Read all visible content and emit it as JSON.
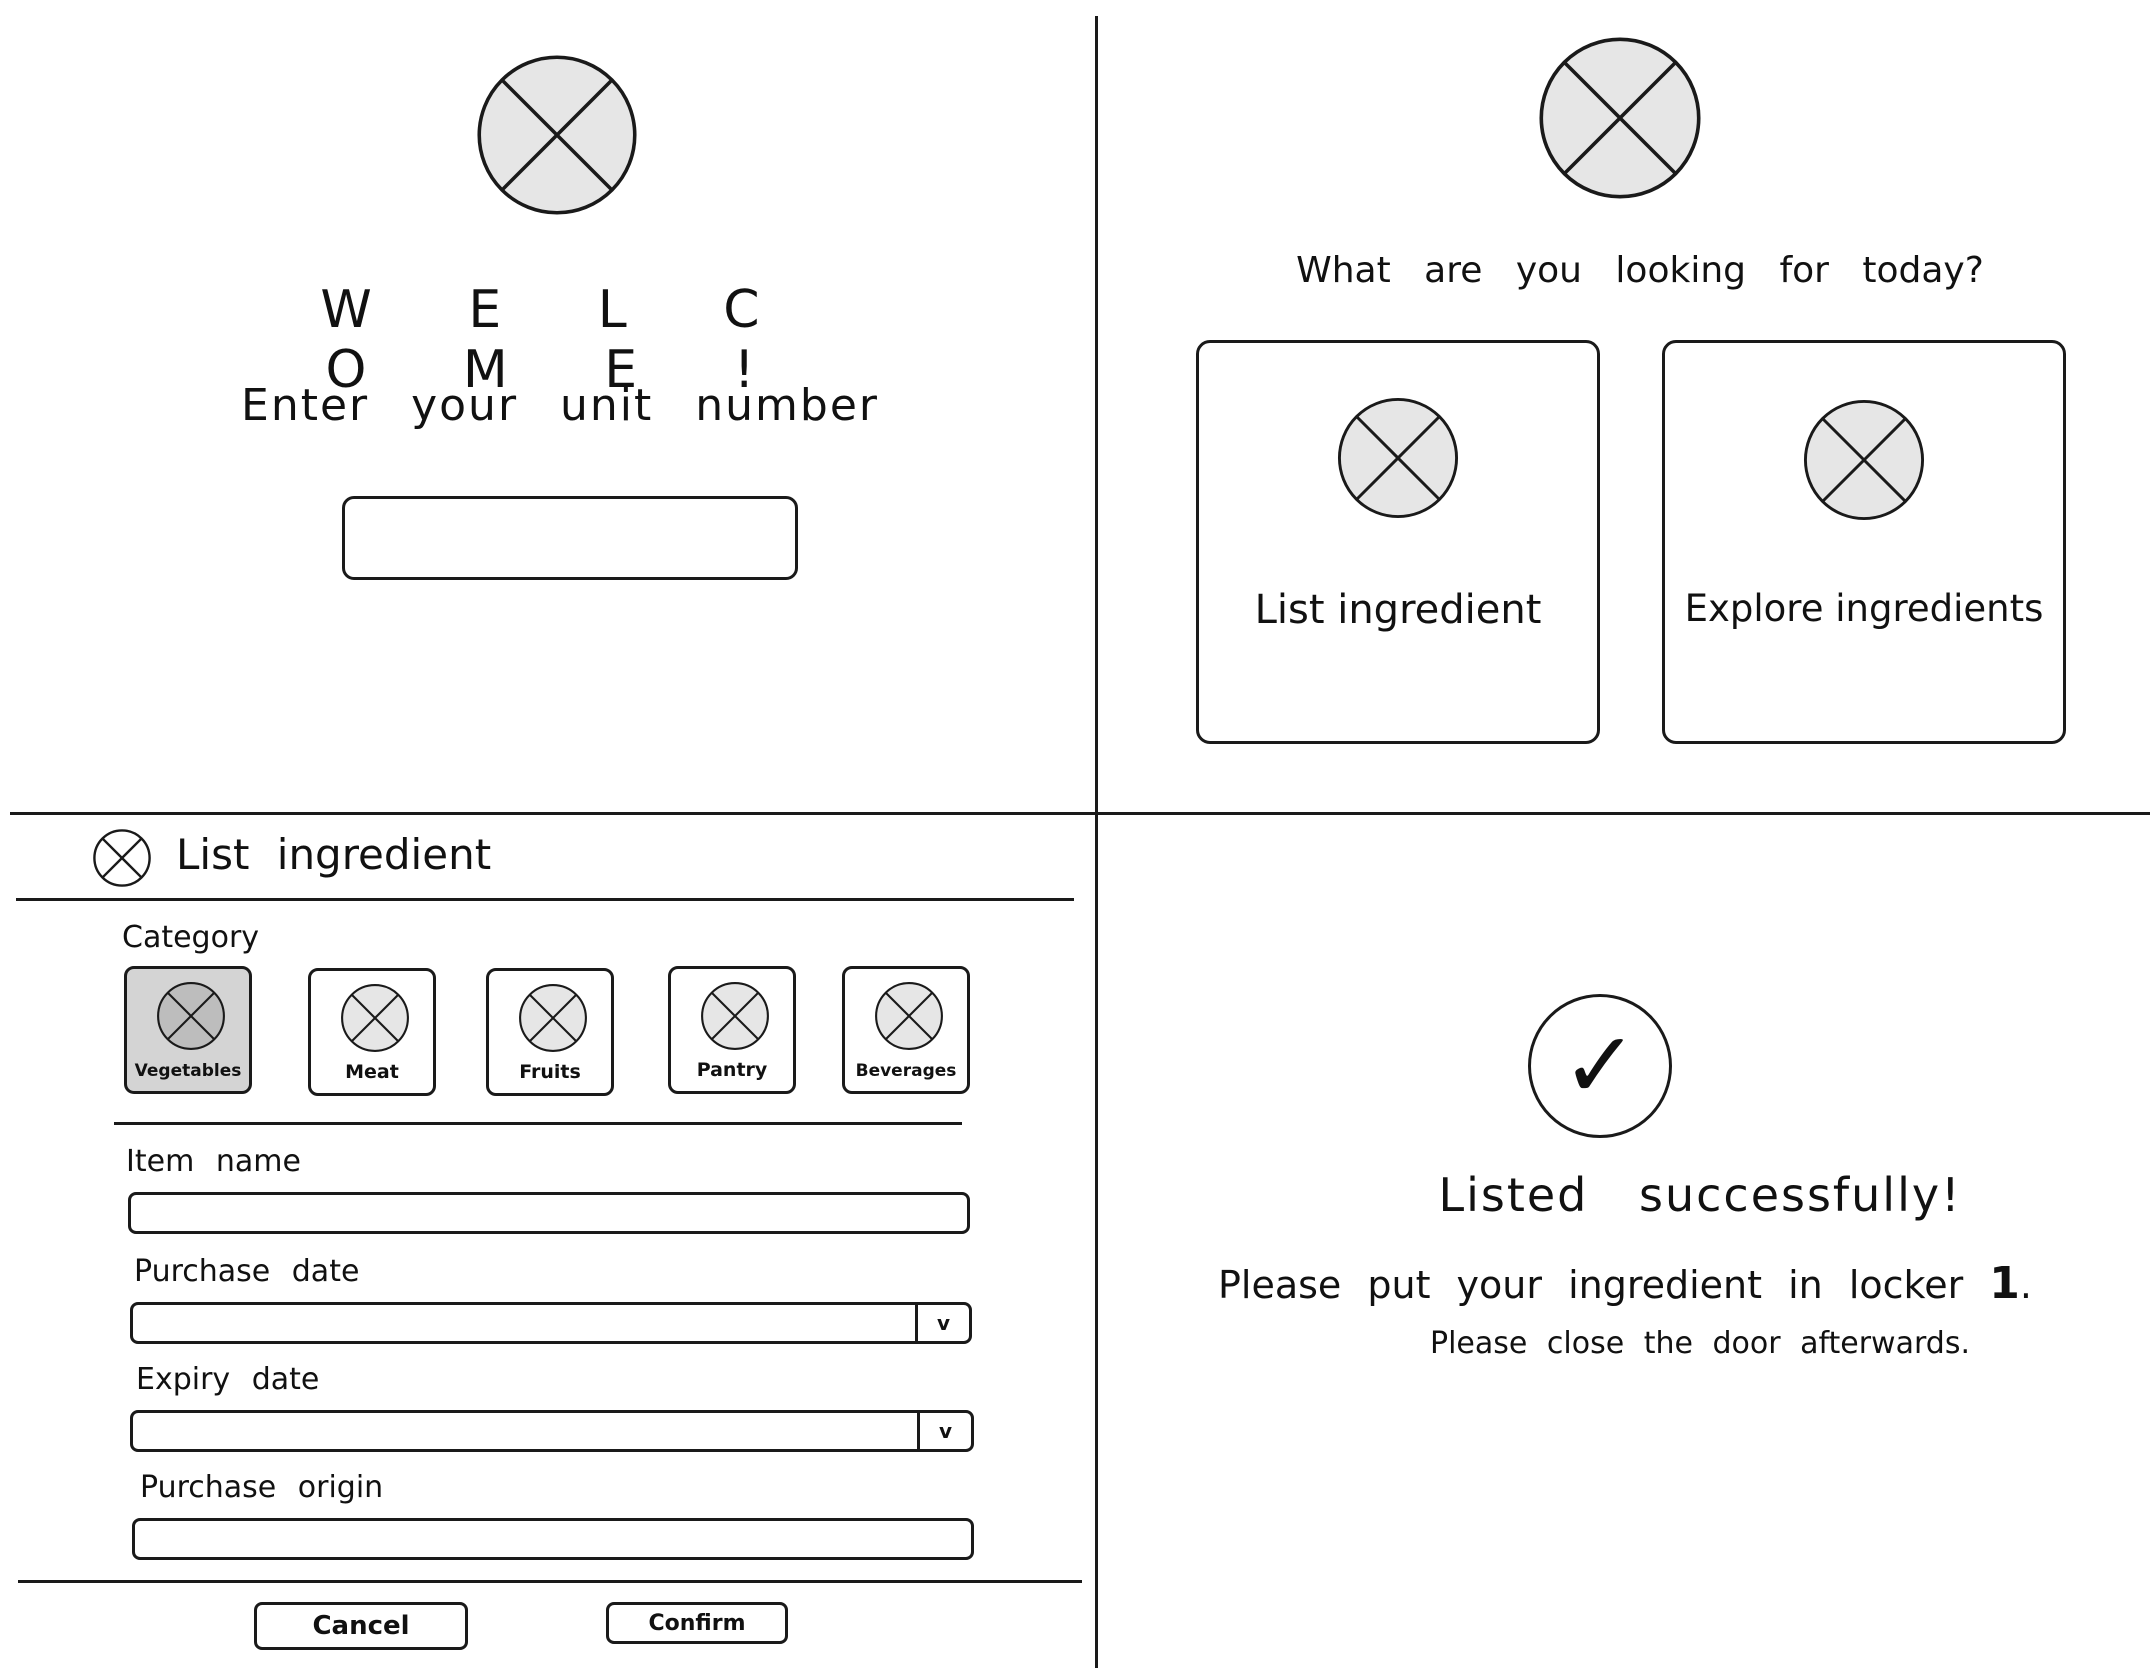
{
  "screens": {
    "welcome": {
      "title": "W E L C O M E !",
      "prompt": "Enter your unit number",
      "unit_input": {
        "value": "",
        "placeholder": ""
      },
      "logo_icon": "image-placeholder-icon"
    },
    "choose": {
      "question": "What are you looking for today?",
      "logo_icon": "image-placeholder-icon",
      "options": [
        {
          "label": "List ingredient",
          "icon": "image-placeholder-icon"
        },
        {
          "label": "Explore ingredients",
          "icon": "image-placeholder-icon"
        }
      ]
    },
    "list_form": {
      "title": "List ingredient",
      "header_icon": "image-placeholder-icon",
      "category_label": "Category",
      "categories": [
        {
          "label": "Vegetables",
          "selected": true
        },
        {
          "label": "Meat",
          "selected": false
        },
        {
          "label": "Fruits",
          "selected": false
        },
        {
          "label": "Pantry",
          "selected": false
        },
        {
          "label": "Beverages",
          "selected": false
        }
      ],
      "fields": {
        "item_name": {
          "label": "Item name",
          "value": ""
        },
        "purchase_date": {
          "label": "Purchase date",
          "value": "",
          "chevron": "v"
        },
        "expiry_date": {
          "label": "Expiry date",
          "value": "",
          "chevron": "v"
        },
        "purchase_origin": {
          "label": "Purchase origin",
          "value": ""
        }
      },
      "cancel_label": "Cancel",
      "confirm_label": "Confirm"
    },
    "success": {
      "check_icon": "checkmark-icon",
      "check_glyph": "✓",
      "title": "Listed successfully!",
      "instruction_prefix": "Please put your ingredient in locker",
      "locker_number": "1",
      "instruction_suffix": ".",
      "note": "Please close the door afterwards."
    }
  },
  "colors": {
    "line": "#1a1a1a",
    "placeholder_fill": "#e6e6e6",
    "selected_fill": "#d4d4d4",
    "background": "#ffffff"
  }
}
